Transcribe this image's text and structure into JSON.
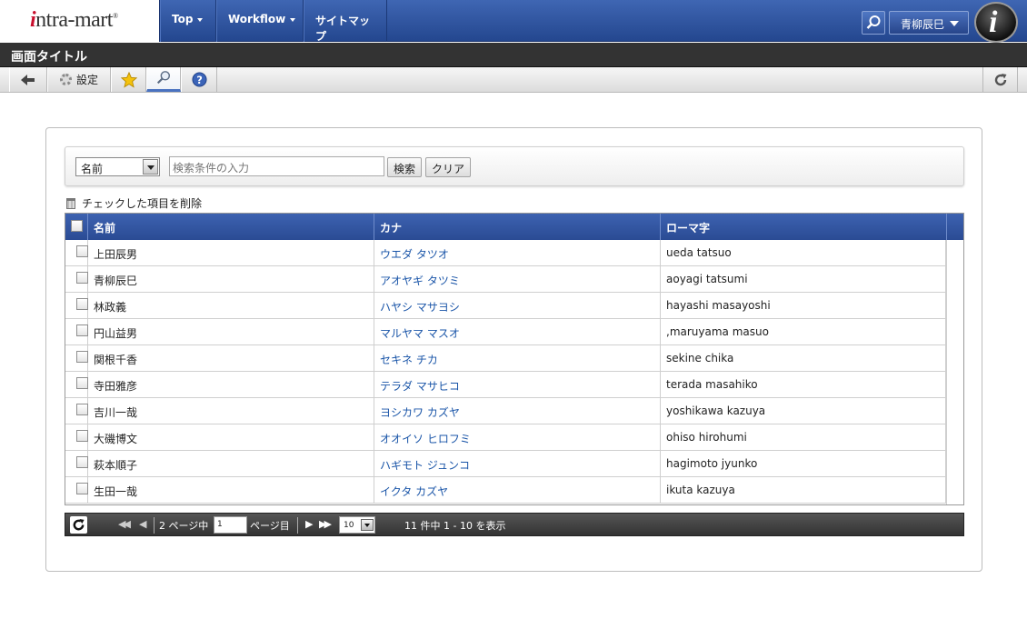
{
  "header": {
    "logo_prefix": "i",
    "logo_text": "ntra-mart",
    "logo_reg": "®",
    "nav": [
      {
        "label": "Top",
        "has_caret": true
      },
      {
        "label": "Workflow",
        "has_caret": true
      },
      {
        "label": "サイトマップ",
        "has_caret": false
      }
    ],
    "user_name": "青柳辰巳",
    "info_letter": "i"
  },
  "page": {
    "title": "画面タイトル"
  },
  "toolbar": {
    "back_icon": "arrow-left-icon",
    "settings_label": "設定",
    "favorite_icon": "star-icon",
    "search_icon": "magnifier-icon",
    "help_icon": "help-icon",
    "reload_icon": "reload-icon"
  },
  "search": {
    "field_selected": "名前",
    "placeholder": "検索条件の入力",
    "search_label": "検索",
    "clear_label": "クリア"
  },
  "delete_checked_label": "チェックした項目を削除",
  "grid": {
    "columns": [
      "名前",
      "カナ",
      "ローマ字"
    ],
    "rows": [
      {
        "name": "上田辰男",
        "kana": "ウエダ タツオ",
        "romaji": "ueda tatsuo"
      },
      {
        "name": "青柳辰巳",
        "kana": "アオヤギ タツミ",
        "romaji": "aoyagi tatsumi"
      },
      {
        "name": "林政義",
        "kana": "ハヤシ マサヨシ",
        "romaji": "hayashi masayoshi"
      },
      {
        "name": "円山益男",
        "kana": "マルヤマ マスオ",
        "romaji": ",maruyama masuo"
      },
      {
        "name": "関根千香",
        "kana": "セキネ チカ",
        "romaji": "sekine chika"
      },
      {
        "name": "寺田雅彦",
        "kana": "テラダ マサヒコ",
        "romaji": "terada masahiko"
      },
      {
        "name": "吉川一哉",
        "kana": "ヨシカワ カズヤ",
        "romaji": "yoshikawa kazuya"
      },
      {
        "name": "大磯博文",
        "kana": "オオイソ ヒロフミ",
        "romaji": "ohiso hirohumi"
      },
      {
        "name": "萩本順子",
        "kana": "ハギモト ジュンコ",
        "romaji": "hagimoto jyunko"
      },
      {
        "name": "生田一哉",
        "kana": "イクタ カズヤ",
        "romaji": "ikuta kazuya"
      }
    ]
  },
  "pager": {
    "first_icon": "◀◀",
    "prev_icon": "◀",
    "total_pages_text": "2 ページ中",
    "current_page": "1",
    "page_suffix": "ページ目",
    "next_icon": "▶",
    "last_icon": "▶▶",
    "rows_per_page": "10",
    "summary": "11 件中 1 - 10 を表示"
  }
}
